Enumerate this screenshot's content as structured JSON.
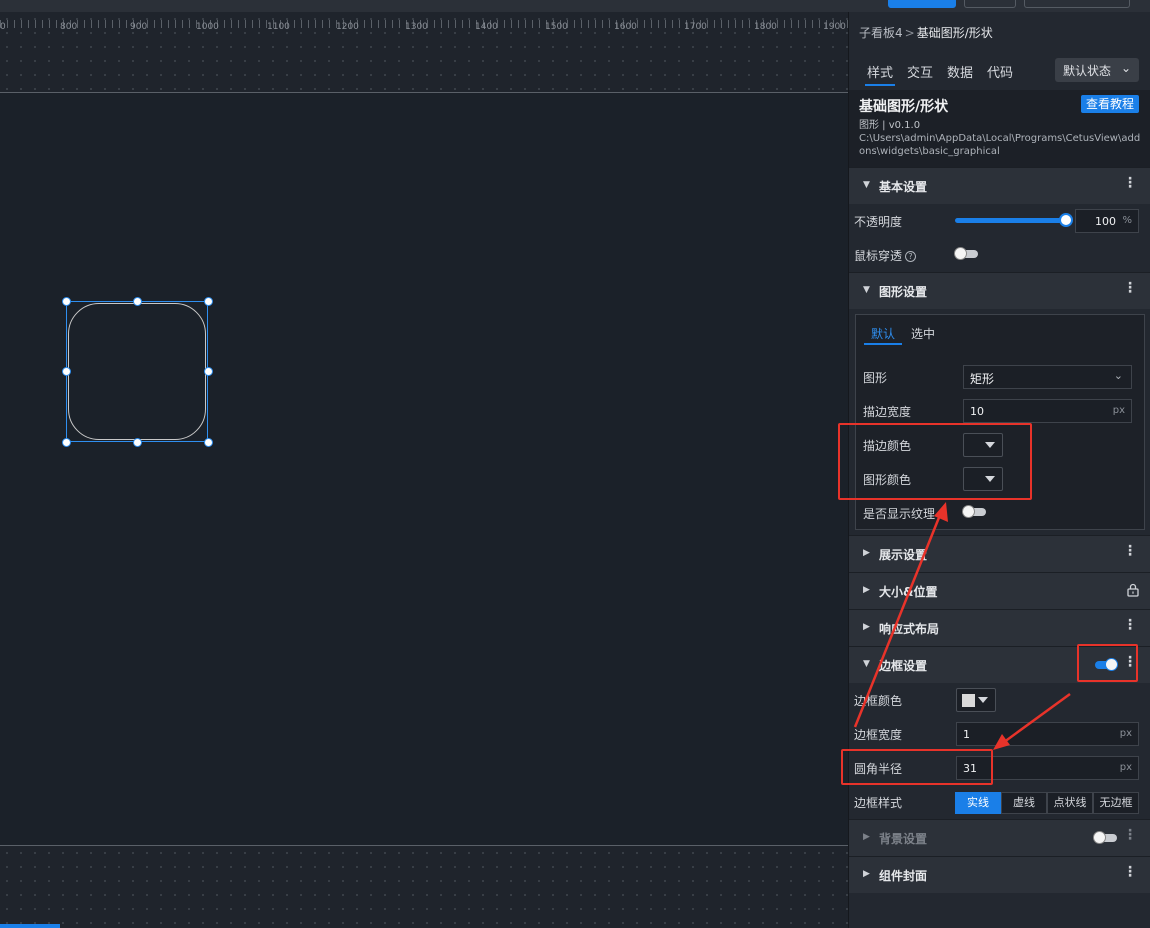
{
  "canvas": {
    "ruler_ticks": [
      "0",
      "800",
      "900",
      "1000",
      "1100",
      "1200",
      "1300",
      "1400",
      "1500",
      "1600",
      "1700",
      "1800",
      "1900"
    ]
  },
  "panel": {
    "breadcrumb": {
      "parent": "子看板4",
      "separator": ">",
      "current": "基础图形/形状"
    },
    "tabs": [
      "样式",
      "交互",
      "数据",
      "代码"
    ],
    "state_select": "默认状态",
    "widget": {
      "title": "基础图形/形状",
      "meta": "图形 | v0.1.0",
      "path": "C:\\Users\\admin\\AppData\\Local\\Programs\\CetusView\\addons\\widgets\\basic_graphical",
      "tutorial_button": "查看教程"
    },
    "basic": {
      "title": "基本设置",
      "opacity_label": "不透明度",
      "opacity_value": "100",
      "opacity_unit": "%",
      "mouse_through_label": "鼠标穿透",
      "help_icon": "?"
    },
    "shape": {
      "title": "图形设置",
      "inner_tabs": [
        "默认",
        "选中"
      ],
      "shape_label": "图形",
      "shape_value": "矩形",
      "stroke_width_label": "描边宽度",
      "stroke_width_value": "10",
      "stroke_width_unit": "px",
      "stroke_color_label": "描边颜色",
      "fill_color_label": "图形颜色",
      "texture_label": "是否显示纹理"
    },
    "sections": {
      "display": "展示设置",
      "size_pos": "大小&位置",
      "responsive": "响应式布局",
      "border": "边框设置",
      "background": "背景设置",
      "cover": "组件封面"
    },
    "border": {
      "color_label": "边框颜色",
      "width_label": "边框宽度",
      "width_value": "1",
      "width_unit": "px",
      "radius_label": "圆角半径",
      "radius_value": "31",
      "radius_unit": "px",
      "style_label": "边框样式",
      "styles": [
        "实线",
        "虚线",
        "点状线",
        "无边框"
      ]
    },
    "more_icon": "⋮"
  },
  "colors": {
    "accent": "#1a7fe8",
    "annotation_red": "#e8332a",
    "border_swatch": "#d9d9d9"
  }
}
